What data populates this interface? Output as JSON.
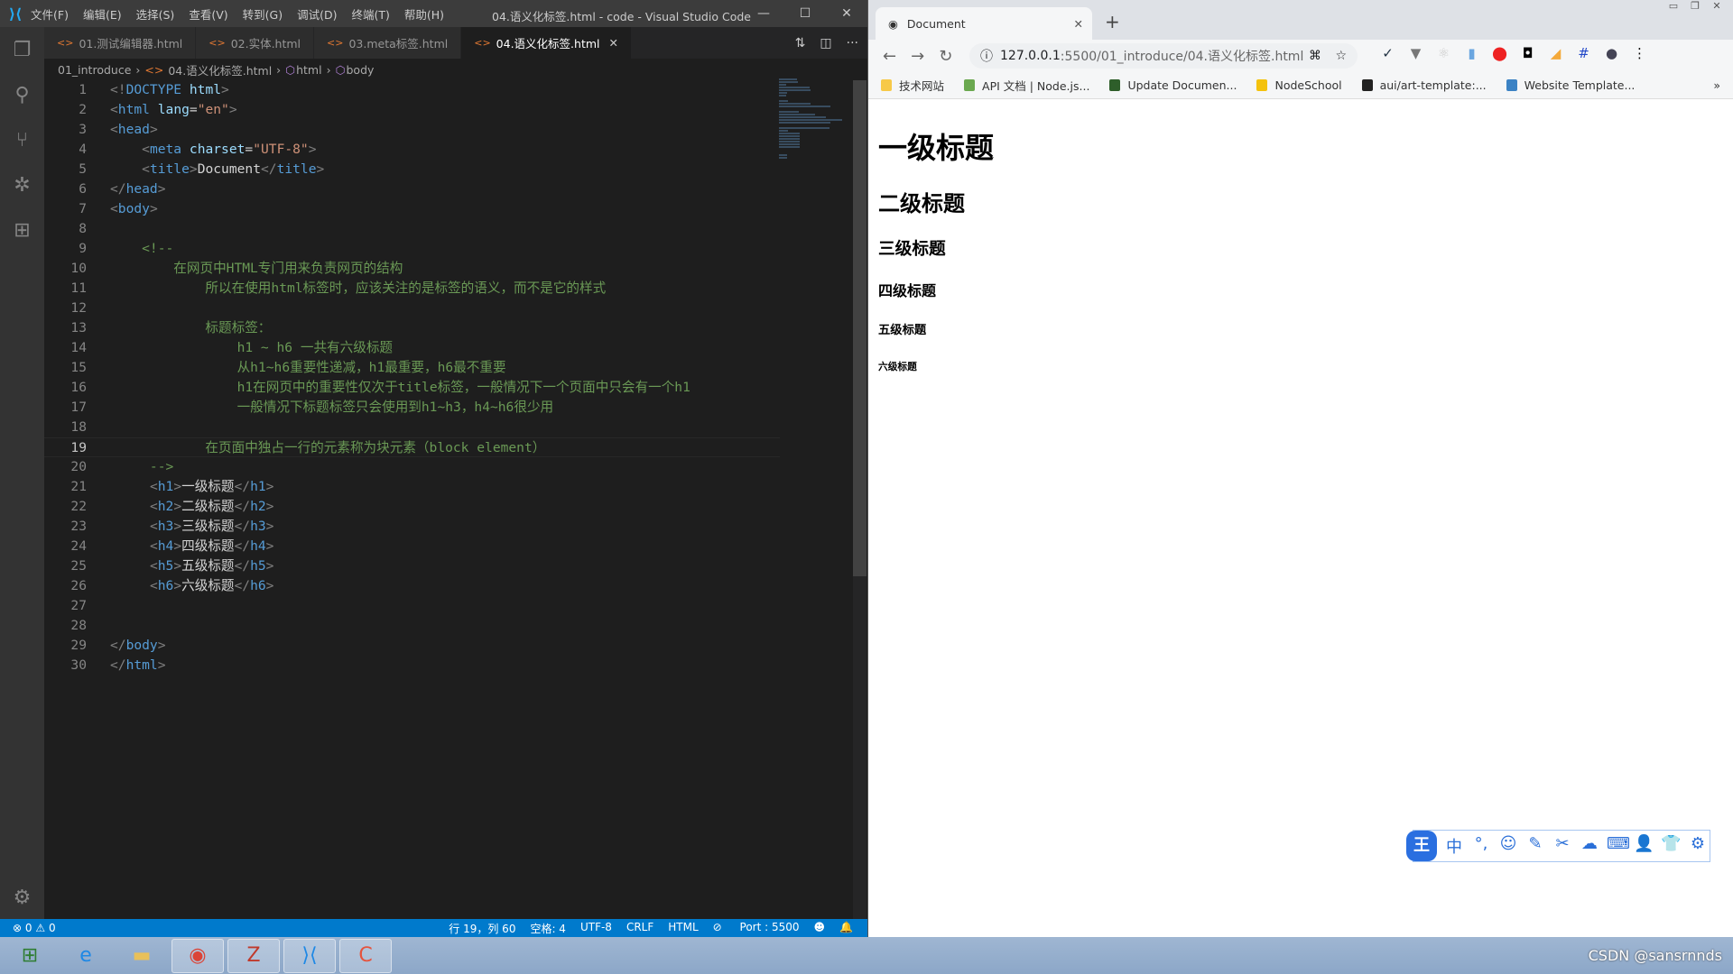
{
  "vscode": {
    "title": "04.语义化标签.html - code - Visual Studio Code",
    "menu": [
      "文件(F)",
      "编辑(E)",
      "选择(S)",
      "查看(V)",
      "转到(G)",
      "调试(D)",
      "终端(T)",
      "帮助(H)"
    ],
    "tabs": [
      {
        "label": "01.测试编辑器.html"
      },
      {
        "label": "02.实体.html"
      },
      {
        "label": "03.meta标签.html"
      },
      {
        "label": "04.语义化标签.html",
        "active": true
      }
    ],
    "breadcrumb": [
      "01_introduce",
      "04.语义化标签.html",
      "html",
      "body"
    ],
    "current_line": 19,
    "lines": [
      [
        [
          "b",
          "<!"
        ],
        [
          "n",
          "DOCTYPE"
        ],
        [
          "x",
          " "
        ],
        [
          "a",
          "html"
        ],
        [
          "b",
          ">"
        ]
      ],
      [
        [
          "b",
          "<"
        ],
        [
          "n",
          "html"
        ],
        [
          "x",
          " "
        ],
        [
          "a",
          "lang"
        ],
        [
          "x",
          "="
        ],
        [
          "s",
          "\"en\""
        ],
        [
          "b",
          ">"
        ]
      ],
      [
        [
          "b",
          "<"
        ],
        [
          "n",
          "head"
        ],
        [
          "b",
          ">"
        ]
      ],
      [
        [
          "x",
          "    "
        ],
        [
          "b",
          "<"
        ],
        [
          "n",
          "meta"
        ],
        [
          "x",
          " "
        ],
        [
          "a",
          "charset"
        ],
        [
          "x",
          "="
        ],
        [
          "s",
          "\"UTF-8\""
        ],
        [
          "b",
          ">"
        ]
      ],
      [
        [
          "x",
          "    "
        ],
        [
          "b",
          "<"
        ],
        [
          "n",
          "title"
        ],
        [
          "b",
          ">"
        ],
        [
          "x",
          "Document"
        ],
        [
          "b",
          "</"
        ],
        [
          "n",
          "title"
        ],
        [
          "b",
          ">"
        ]
      ],
      [
        [
          "b",
          "</"
        ],
        [
          "n",
          "head"
        ],
        [
          "b",
          ">"
        ]
      ],
      [
        [
          "b",
          "<"
        ],
        [
          "n",
          "body"
        ],
        [
          "b",
          ">"
        ]
      ],
      [],
      [
        [
          "c",
          "    <!--"
        ]
      ],
      [
        [
          "c",
          "        在网页中HTML专门用来负责网页的结构"
        ]
      ],
      [
        [
          "c",
          "            所以在使用html标签时，应该关注的是标签的语义，而不是它的样式"
        ]
      ],
      [],
      [
        [
          "c",
          "            标题标签："
        ]
      ],
      [
        [
          "c",
          "                h1 ~ h6 一共有六级标题"
        ]
      ],
      [
        [
          "c",
          "                从h1~h6重要性递减，h1最重要，h6最不重要"
        ]
      ],
      [
        [
          "c",
          "                h1在网页中的重要性仅次于title标签，一般情况下一个页面中只会有一个h1"
        ]
      ],
      [
        [
          "c",
          "                一般情况下标题标签只会使用到h1~h3，h4~h6很少用"
        ]
      ],
      [],
      [
        [
          "c",
          "            在页面中独占一行的元素称为块元素（block element）"
        ]
      ],
      [
        [
          "c",
          "     -->"
        ]
      ],
      [
        [
          "x",
          "     "
        ],
        [
          "b",
          "<"
        ],
        [
          "n",
          "h1"
        ],
        [
          "b",
          ">"
        ],
        [
          "x",
          "一级标题"
        ],
        [
          "b",
          "</"
        ],
        [
          "n",
          "h1"
        ],
        [
          "b",
          ">"
        ]
      ],
      [
        [
          "x",
          "     "
        ],
        [
          "b",
          "<"
        ],
        [
          "n",
          "h2"
        ],
        [
          "b",
          ">"
        ],
        [
          "x",
          "二级标题"
        ],
        [
          "b",
          "</"
        ],
        [
          "n",
          "h2"
        ],
        [
          "b",
          ">"
        ]
      ],
      [
        [
          "x",
          "     "
        ],
        [
          "b",
          "<"
        ],
        [
          "n",
          "h3"
        ],
        [
          "b",
          ">"
        ],
        [
          "x",
          "三级标题"
        ],
        [
          "b",
          "</"
        ],
        [
          "n",
          "h3"
        ],
        [
          "b",
          ">"
        ]
      ],
      [
        [
          "x",
          "     "
        ],
        [
          "b",
          "<"
        ],
        [
          "n",
          "h4"
        ],
        [
          "b",
          ">"
        ],
        [
          "x",
          "四级标题"
        ],
        [
          "b",
          "</"
        ],
        [
          "n",
          "h4"
        ],
        [
          "b",
          ">"
        ]
      ],
      [
        [
          "x",
          "     "
        ],
        [
          "b",
          "<"
        ],
        [
          "n",
          "h5"
        ],
        [
          "b",
          ">"
        ],
        [
          "x",
          "五级标题"
        ],
        [
          "b",
          "</"
        ],
        [
          "n",
          "h5"
        ],
        [
          "b",
          ">"
        ]
      ],
      [
        [
          "x",
          "     "
        ],
        [
          "b",
          "<"
        ],
        [
          "n",
          "h6"
        ],
        [
          "b",
          ">"
        ],
        [
          "x",
          "六级标题"
        ],
        [
          "b",
          "</"
        ],
        [
          "n",
          "h6"
        ],
        [
          "b",
          ">"
        ]
      ],
      [],
      [],
      [
        [
          "b",
          "</"
        ],
        [
          "n",
          "body"
        ],
        [
          "b",
          ">"
        ]
      ],
      [
        [
          "b",
          "</"
        ],
        [
          "n",
          "html"
        ],
        [
          "b",
          ">"
        ]
      ]
    ],
    "status": {
      "errors": "0",
      "warnings": "0",
      "position": "行 19，列 60",
      "spaces": "空格: 4",
      "encoding": "UTF-8",
      "eol": "CRLF",
      "language": "HTML",
      "port": "Port : 5500"
    }
  },
  "browser": {
    "tab_title": "Document",
    "url_host": "127.0.0.1",
    "url_rest": ":5500/01_introduce/04.语义化标签.html",
    "bookmarks": [
      {
        "label": "技术网站",
        "color": "#f7c948"
      },
      {
        "label": "API 文档 | Node.js...",
        "color": "#6aa84f"
      },
      {
        "label": "Update Documen...",
        "color": "#2e5e2a"
      },
      {
        "label": "NodeSchool",
        "color": "#f4c20d"
      },
      {
        "label": "aui/art-template:...",
        "color": "#222222"
      },
      {
        "label": "Website Template...",
        "color": "#3b82c4"
      }
    ],
    "headings": [
      "一级标题",
      "二级标题",
      "三级标题",
      "四级标题",
      "五级标题",
      "六级标题"
    ]
  },
  "ime": {
    "logo": "王",
    "items": [
      "中",
      "°,",
      "☺",
      "✎",
      "✂",
      "☁",
      "⌨",
      "👤",
      "👕",
      "⚙"
    ]
  },
  "watermark": "CSDN @sansrnnds",
  "colors": {
    "accent": "#007acc",
    "titlebar": "#3c3c3c",
    "editor_bg": "#1e1e1e"
  }
}
